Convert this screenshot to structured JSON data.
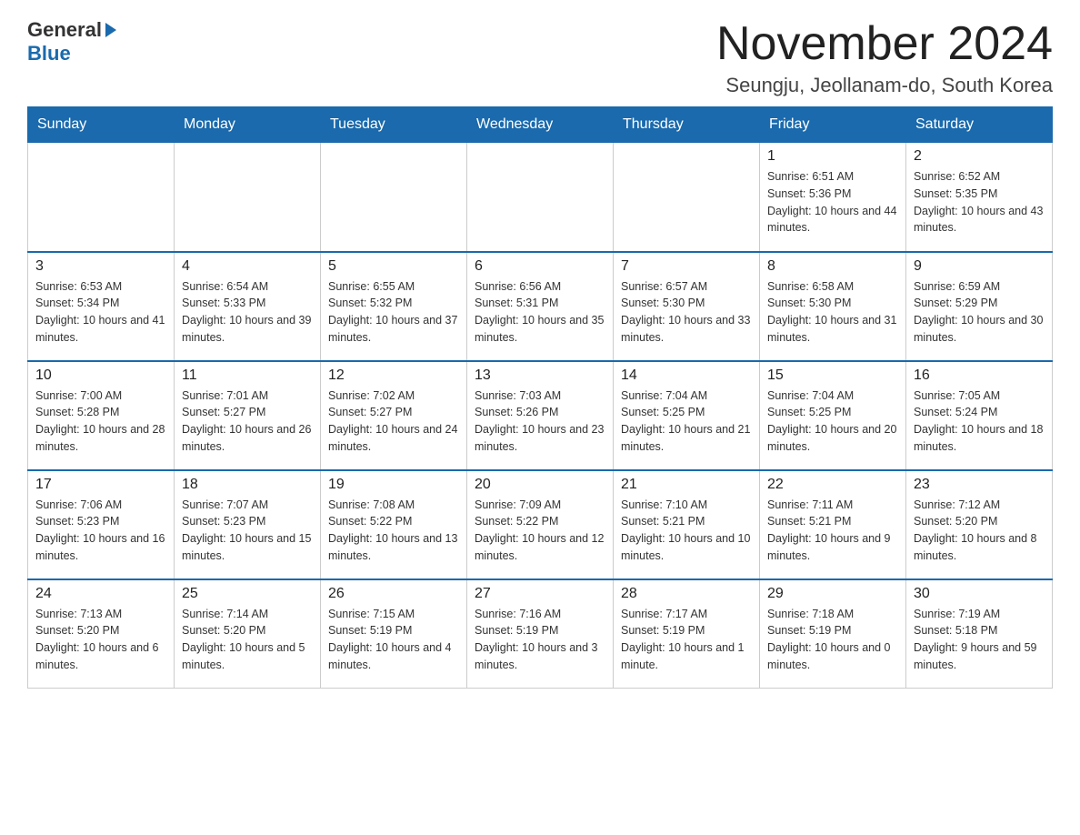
{
  "header": {
    "logo_general": "General",
    "logo_blue": "Blue",
    "month_title": "November 2024",
    "location": "Seungju, Jeollanam-do, South Korea"
  },
  "days_of_week": [
    "Sunday",
    "Monday",
    "Tuesday",
    "Wednesday",
    "Thursday",
    "Friday",
    "Saturday"
  ],
  "weeks": [
    [
      {
        "day": "",
        "sunrise": "",
        "sunset": "",
        "daylight": ""
      },
      {
        "day": "",
        "sunrise": "",
        "sunset": "",
        "daylight": ""
      },
      {
        "day": "",
        "sunrise": "",
        "sunset": "",
        "daylight": ""
      },
      {
        "day": "",
        "sunrise": "",
        "sunset": "",
        "daylight": ""
      },
      {
        "day": "",
        "sunrise": "",
        "sunset": "",
        "daylight": ""
      },
      {
        "day": "1",
        "sunrise": "Sunrise: 6:51 AM",
        "sunset": "Sunset: 5:36 PM",
        "daylight": "Daylight: 10 hours and 44 minutes."
      },
      {
        "day": "2",
        "sunrise": "Sunrise: 6:52 AM",
        "sunset": "Sunset: 5:35 PM",
        "daylight": "Daylight: 10 hours and 43 minutes."
      }
    ],
    [
      {
        "day": "3",
        "sunrise": "Sunrise: 6:53 AM",
        "sunset": "Sunset: 5:34 PM",
        "daylight": "Daylight: 10 hours and 41 minutes."
      },
      {
        "day": "4",
        "sunrise": "Sunrise: 6:54 AM",
        "sunset": "Sunset: 5:33 PM",
        "daylight": "Daylight: 10 hours and 39 minutes."
      },
      {
        "day": "5",
        "sunrise": "Sunrise: 6:55 AM",
        "sunset": "Sunset: 5:32 PM",
        "daylight": "Daylight: 10 hours and 37 minutes."
      },
      {
        "day": "6",
        "sunrise": "Sunrise: 6:56 AM",
        "sunset": "Sunset: 5:31 PM",
        "daylight": "Daylight: 10 hours and 35 minutes."
      },
      {
        "day": "7",
        "sunrise": "Sunrise: 6:57 AM",
        "sunset": "Sunset: 5:30 PM",
        "daylight": "Daylight: 10 hours and 33 minutes."
      },
      {
        "day": "8",
        "sunrise": "Sunrise: 6:58 AM",
        "sunset": "Sunset: 5:30 PM",
        "daylight": "Daylight: 10 hours and 31 minutes."
      },
      {
        "day": "9",
        "sunrise": "Sunrise: 6:59 AM",
        "sunset": "Sunset: 5:29 PM",
        "daylight": "Daylight: 10 hours and 30 minutes."
      }
    ],
    [
      {
        "day": "10",
        "sunrise": "Sunrise: 7:00 AM",
        "sunset": "Sunset: 5:28 PM",
        "daylight": "Daylight: 10 hours and 28 minutes."
      },
      {
        "day": "11",
        "sunrise": "Sunrise: 7:01 AM",
        "sunset": "Sunset: 5:27 PM",
        "daylight": "Daylight: 10 hours and 26 minutes."
      },
      {
        "day": "12",
        "sunrise": "Sunrise: 7:02 AM",
        "sunset": "Sunset: 5:27 PM",
        "daylight": "Daylight: 10 hours and 24 minutes."
      },
      {
        "day": "13",
        "sunrise": "Sunrise: 7:03 AM",
        "sunset": "Sunset: 5:26 PM",
        "daylight": "Daylight: 10 hours and 23 minutes."
      },
      {
        "day": "14",
        "sunrise": "Sunrise: 7:04 AM",
        "sunset": "Sunset: 5:25 PM",
        "daylight": "Daylight: 10 hours and 21 minutes."
      },
      {
        "day": "15",
        "sunrise": "Sunrise: 7:04 AM",
        "sunset": "Sunset: 5:25 PM",
        "daylight": "Daylight: 10 hours and 20 minutes."
      },
      {
        "day": "16",
        "sunrise": "Sunrise: 7:05 AM",
        "sunset": "Sunset: 5:24 PM",
        "daylight": "Daylight: 10 hours and 18 minutes."
      }
    ],
    [
      {
        "day": "17",
        "sunrise": "Sunrise: 7:06 AM",
        "sunset": "Sunset: 5:23 PM",
        "daylight": "Daylight: 10 hours and 16 minutes."
      },
      {
        "day": "18",
        "sunrise": "Sunrise: 7:07 AM",
        "sunset": "Sunset: 5:23 PM",
        "daylight": "Daylight: 10 hours and 15 minutes."
      },
      {
        "day": "19",
        "sunrise": "Sunrise: 7:08 AM",
        "sunset": "Sunset: 5:22 PM",
        "daylight": "Daylight: 10 hours and 13 minutes."
      },
      {
        "day": "20",
        "sunrise": "Sunrise: 7:09 AM",
        "sunset": "Sunset: 5:22 PM",
        "daylight": "Daylight: 10 hours and 12 minutes."
      },
      {
        "day": "21",
        "sunrise": "Sunrise: 7:10 AM",
        "sunset": "Sunset: 5:21 PM",
        "daylight": "Daylight: 10 hours and 10 minutes."
      },
      {
        "day": "22",
        "sunrise": "Sunrise: 7:11 AM",
        "sunset": "Sunset: 5:21 PM",
        "daylight": "Daylight: 10 hours and 9 minutes."
      },
      {
        "day": "23",
        "sunrise": "Sunrise: 7:12 AM",
        "sunset": "Sunset: 5:20 PM",
        "daylight": "Daylight: 10 hours and 8 minutes."
      }
    ],
    [
      {
        "day": "24",
        "sunrise": "Sunrise: 7:13 AM",
        "sunset": "Sunset: 5:20 PM",
        "daylight": "Daylight: 10 hours and 6 minutes."
      },
      {
        "day": "25",
        "sunrise": "Sunrise: 7:14 AM",
        "sunset": "Sunset: 5:20 PM",
        "daylight": "Daylight: 10 hours and 5 minutes."
      },
      {
        "day": "26",
        "sunrise": "Sunrise: 7:15 AM",
        "sunset": "Sunset: 5:19 PM",
        "daylight": "Daylight: 10 hours and 4 minutes."
      },
      {
        "day": "27",
        "sunrise": "Sunrise: 7:16 AM",
        "sunset": "Sunset: 5:19 PM",
        "daylight": "Daylight: 10 hours and 3 minutes."
      },
      {
        "day": "28",
        "sunrise": "Sunrise: 7:17 AM",
        "sunset": "Sunset: 5:19 PM",
        "daylight": "Daylight: 10 hours and 1 minute."
      },
      {
        "day": "29",
        "sunrise": "Sunrise: 7:18 AM",
        "sunset": "Sunset: 5:19 PM",
        "daylight": "Daylight: 10 hours and 0 minutes."
      },
      {
        "day": "30",
        "sunrise": "Sunrise: 7:19 AM",
        "sunset": "Sunset: 5:18 PM",
        "daylight": "Daylight: 9 hours and 59 minutes."
      }
    ]
  ]
}
